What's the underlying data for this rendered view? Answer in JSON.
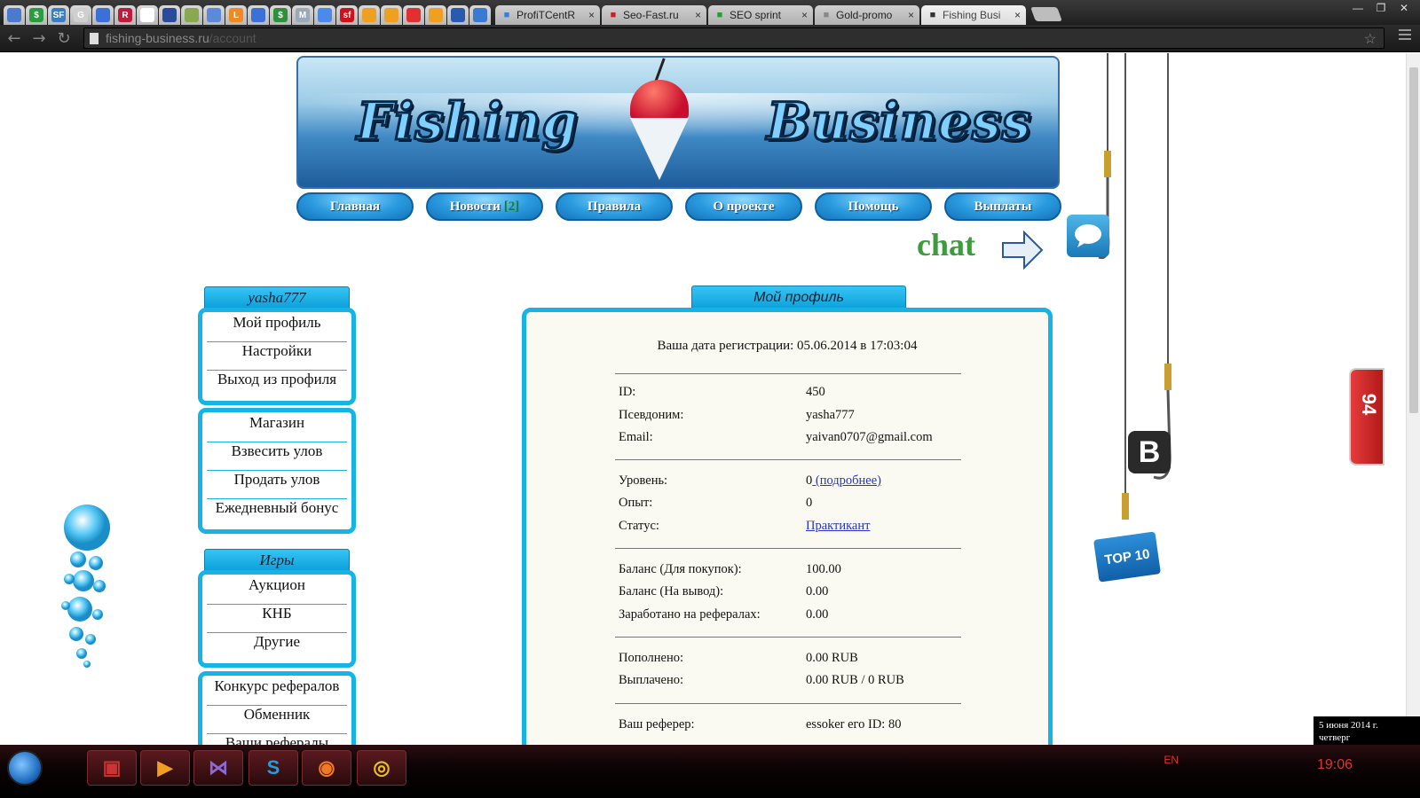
{
  "browser": {
    "tabs": [
      {
        "title": "ProfiTCentR",
        "fav_color": "#3b7ed8"
      },
      {
        "title": "Seo-Fast.ru",
        "fav_color": "#cc2020"
      },
      {
        "title": "SEO sprint",
        "fav_color": "#2a9a3a"
      },
      {
        "title": "Gold-promo",
        "fav_color": "#888888"
      },
      {
        "title": "Fishing Busi",
        "fav_color": "#333333"
      }
    ],
    "pinned_favicons": [
      {
        "label": "",
        "color": "#4a7ad0"
      },
      {
        "label": "$",
        "color": "#2b9c3d"
      },
      {
        "label": "SF",
        "color": "#3a7dc0"
      },
      {
        "label": "G",
        "color": "#cfcfcf"
      },
      {
        "label": "",
        "color": "#3a70d8"
      },
      {
        "label": "R",
        "color": "#c01b3a"
      },
      {
        "label": "",
        "color": "#ffffff"
      },
      {
        "label": "",
        "color": "#2a4a9a"
      },
      {
        "label": "",
        "color": "#8aa850"
      },
      {
        "label": "",
        "color": "#5a8ad8"
      },
      {
        "label": "L",
        "color": "#f08a20"
      },
      {
        "label": "",
        "color": "#3a70d8"
      },
      {
        "label": "$",
        "color": "#2f8f3a"
      },
      {
        "label": "M",
        "color": "#9aa8b8"
      },
      {
        "label": "",
        "color": "#4a8ae8"
      },
      {
        "label": "sf",
        "color": "#d0101a"
      },
      {
        "label": "",
        "color": "#f0a020"
      },
      {
        "label": "",
        "color": "#f0a020"
      },
      {
        "label": "",
        "color": "#e03030"
      },
      {
        "label": "",
        "color": "#f0a020"
      },
      {
        "label": "",
        "color": "#2a5ab0"
      },
      {
        "label": "",
        "color": "#3a7ad0"
      }
    ],
    "url_domain": "fishing-business.ru",
    "url_path": "/account"
  },
  "site": {
    "logo_word1": "Fishing",
    "logo_word2": "Business",
    "nav": [
      {
        "label": "Главная"
      },
      {
        "label": "Новости",
        "badge": "[2]"
      },
      {
        "label": "Правила"
      },
      {
        "label": "О проекте"
      },
      {
        "label": "Помощь"
      },
      {
        "label": "Выплаты"
      }
    ],
    "chat_label": "chat",
    "b_badge": "B",
    "top10_label": "TOP 10",
    "side_widget_label": "94"
  },
  "sidebar": {
    "username": "yasha777",
    "account_menu": [
      "Мой профиль",
      "Настройки",
      "Выход из профиля"
    ],
    "shop_menu": [
      "Магазин",
      "Взвесить улов",
      "Продать улов",
      "Ежедневный бонус"
    ],
    "games_header": "Игры",
    "games_menu": [
      "Аукцион",
      "КНБ",
      "Другие"
    ],
    "extra_menu": [
      "Конкурс рефералов",
      "Обменник",
      "Ваши рефералы"
    ]
  },
  "profile": {
    "tab_title": "Мой профиль",
    "registration": "Ваша дата регистрации: 05.06.2014 в 17:03:04",
    "id_label": "ID:",
    "id_value": "450",
    "nick_label": "Псевдоним:",
    "nick_value": "yasha777",
    "email_label": "Email:",
    "email_value": "yaivan0707@gmail.com",
    "level_label": "Уровень:",
    "level_value": "0",
    "level_link": " (подробнее)",
    "exp_label": "Опыт:",
    "exp_value": "0",
    "status_label": "Статус:",
    "status_value": "Практикант",
    "balance_buy_label": "Баланс (Для покупок):",
    "balance_buy_value": "100.00",
    "balance_out_label": "Баланс (На вывод):",
    "balance_out_value": "0.00",
    "ref_earn_label": "Заработано на рефералах:",
    "ref_earn_value": "0.00",
    "deposited_label": "Пополнено:",
    "deposited_value": "0.00 RUB",
    "paid_label": "Выплачено:",
    "paid_value": "0.00 RUB / 0 RUB",
    "referrer_label": "Ваш реферер:",
    "referrer_value": "essoker его ID: 80"
  },
  "taskbar": {
    "lang": "EN",
    "time": "19:06",
    "date_line1": "5 июня 2014 г.",
    "date_line2": "четверг"
  }
}
